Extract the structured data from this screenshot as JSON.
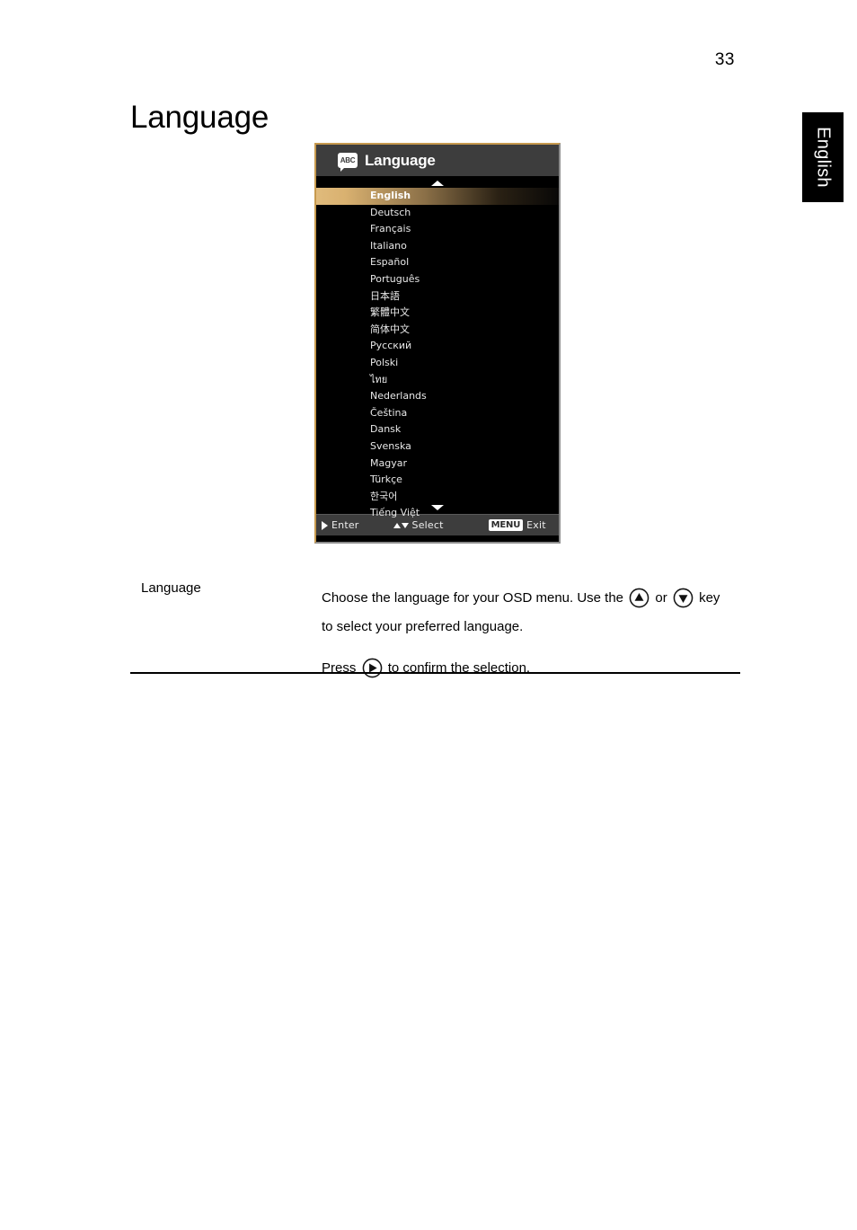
{
  "page": {
    "number": "33",
    "side_tab_label": "English",
    "title": "Language"
  },
  "osd": {
    "icon_name": "abc-speech-bubble-icon",
    "icon_text": "ABC",
    "title": "Language",
    "scroll_up_icon": "triangle-up-icon",
    "scroll_down_icon": "triangle-down-icon",
    "selected_index": 0,
    "languages": [
      "English",
      "Deutsch",
      "Français",
      "Italiano",
      "Español",
      "Português",
      "日本語",
      "繁體中文",
      "简体中文",
      "Русский",
      "Polski",
      "ไทย",
      "Nederlands",
      "Čeština",
      "Dansk",
      "Svenska",
      "Magyar",
      "Türkçe",
      "한국어",
      "Tiếng Việt"
    ],
    "footer": {
      "enter_label": "Enter",
      "select_label": "Select",
      "menu_key_label": "MENU",
      "exit_label": "Exit"
    },
    "colors": {
      "titlebar_bg": "#3d3d3d",
      "body_bg": "#000000",
      "highlight_gold": "#e0bb7c",
      "border_gold": "#c79a4e"
    }
  },
  "description": {
    "term": "Language",
    "line1_part1": "Choose the language for your OSD menu. Use the",
    "line1_or": "or",
    "line1_part2": "key to select your preferred language.",
    "line2_part1": "Press",
    "line2_part2": "to confirm the selection."
  }
}
